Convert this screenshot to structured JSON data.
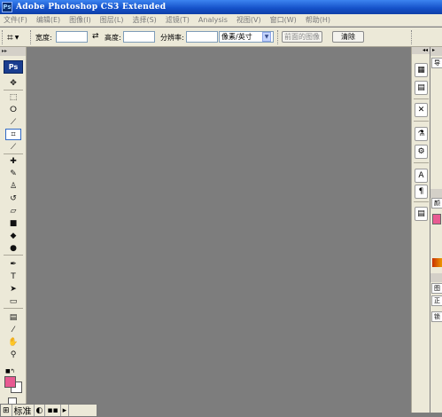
{
  "window": {
    "icon_label": "Ps",
    "title": "Adobe Photoshop CS3 Extended"
  },
  "menu": [
    "文件(F)",
    "编辑(E)",
    "图像(I)",
    "图层(L)",
    "选择(S)",
    "滤镜(T)",
    "Analysis",
    "视图(V)",
    "窗口(W)",
    "帮助(H)"
  ],
  "options": {
    "width_label": "宽度:",
    "width_value": "",
    "height_label": "高度:",
    "height_value": "",
    "resolution_label": "分辨率:",
    "resolution_value": "",
    "unit_selected": "像素/英寸",
    "front_image_button": "前面的图像",
    "clear_button": "清除"
  },
  "toolbox": {
    "logo": "Ps",
    "tools": [
      {
        "name": "move-tool",
        "glyph": "➤"
      },
      {
        "name": "marquee-tool",
        "glyph": "⬚"
      },
      {
        "name": "lasso-tool",
        "glyph": "ↂ"
      },
      {
        "name": "magic-wand-tool",
        "glyph": "⟋"
      },
      {
        "name": "crop-tool",
        "glyph": "⌗",
        "selected": true
      },
      {
        "name": "slice-tool",
        "glyph": "⟋"
      },
      {
        "name": "healing-brush-tool",
        "glyph": "✚"
      },
      {
        "name": "brush-tool",
        "glyph": "✎"
      },
      {
        "name": "clone-stamp-tool",
        "glyph": "♙"
      },
      {
        "name": "history-brush-tool",
        "glyph": "↺"
      },
      {
        "name": "eraser-tool",
        "glyph": "▱"
      },
      {
        "name": "gradient-tool",
        "glyph": "■"
      },
      {
        "name": "blur-tool",
        "glyph": "●"
      },
      {
        "name": "dodge-tool",
        "glyph": "●"
      },
      {
        "name": "pen-tool",
        "glyph": "✒"
      },
      {
        "name": "type-tool",
        "glyph": "T"
      },
      {
        "name": "path-selection-tool",
        "glyph": "➤"
      },
      {
        "name": "shape-tool",
        "glyph": "▭"
      },
      {
        "name": "notes-tool",
        "glyph": "▤"
      },
      {
        "name": "eyedropper-tool",
        "glyph": "⁄"
      },
      {
        "name": "hand-tool",
        "glyph": "✋"
      },
      {
        "name": "zoom-tool",
        "glyph": "⚲"
      }
    ],
    "foreground_color": "#e85a92",
    "background_color": "#ffffff"
  },
  "dock": {
    "buttons": [
      "navigator-icon",
      "history-icon",
      "tools-preset-icon",
      "brushes-icon",
      "clone-source-icon",
      "character-icon",
      "paragraph-icon",
      "layers-comps-icon"
    ]
  },
  "right_panels": {
    "tab1": "导",
    "tab2": "颜",
    "tab3": "图",
    "tab4": "正",
    "tab5": "锁"
  },
  "status": {
    "mode_label": "标准"
  }
}
